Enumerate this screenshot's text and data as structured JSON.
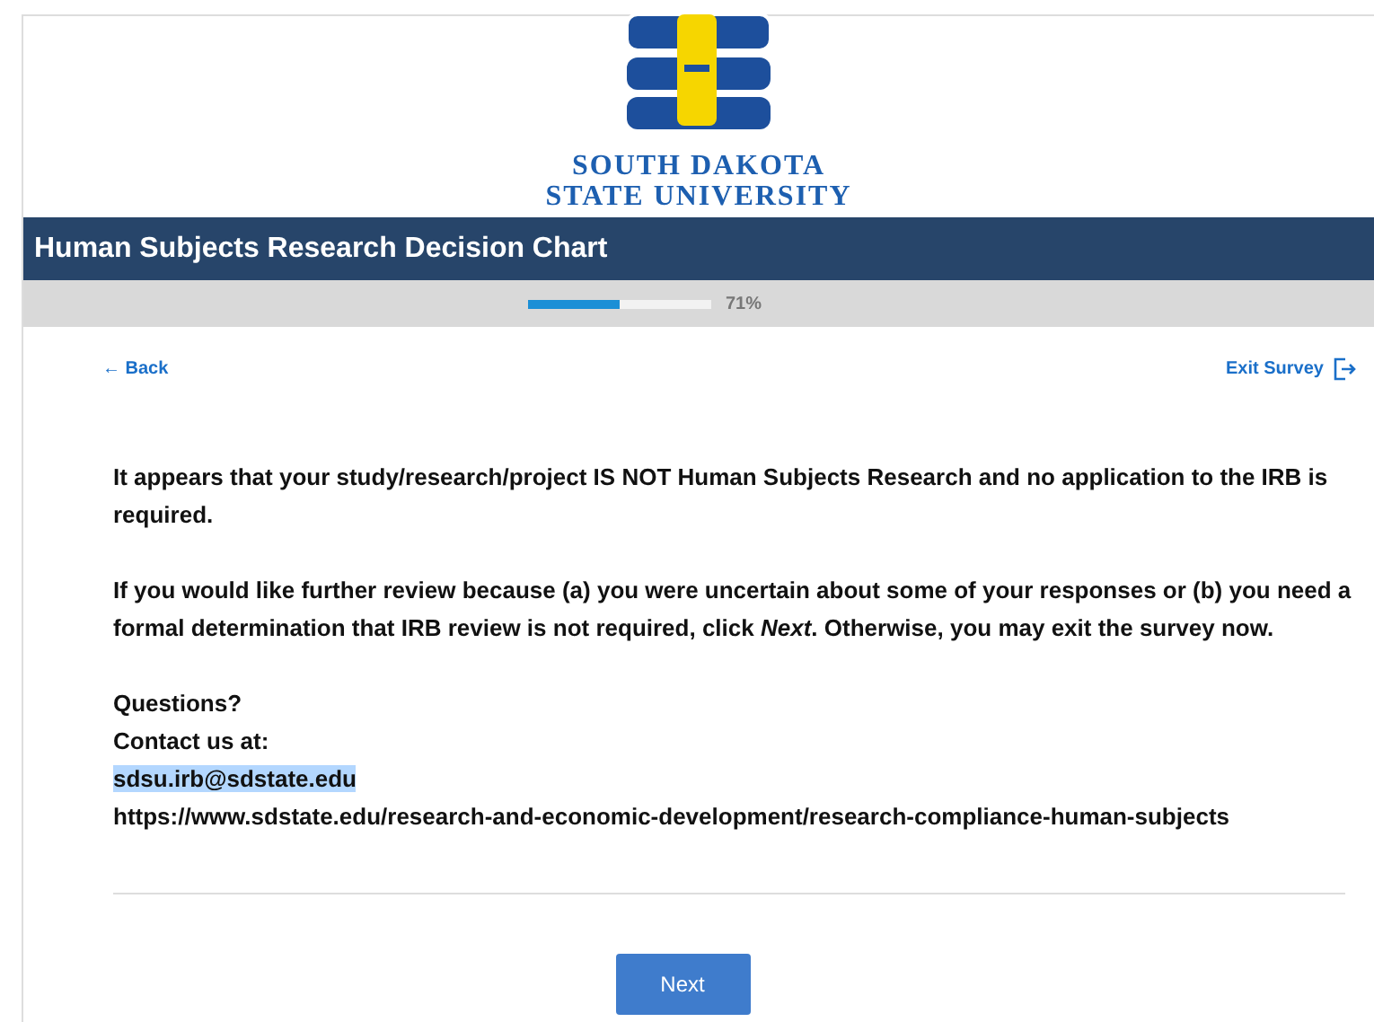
{
  "logo": {
    "line_1": "SOUTH DAKOTA",
    "line_2": "STATE UNIVERSITY"
  },
  "header": {
    "title": "Human Subjects Research Decision Chart"
  },
  "progress": {
    "level": 0.5,
    "reading": "71%"
  },
  "nav": {
    "back": "← Back",
    "exit": "Exit Survey"
  },
  "paragraphs": [
    "It appears that your study/research/project IS NOT Human Subjects Research and no application to the IRB is required.",
    "If you would like further review because (a) you were uncertain about some of your responses or (b) you need a formal determination that IRB review is not required, click *Next*. Otherwise, you may exit the survey now."
  ],
  "contact": {
    "lines": [
      "Questions?",
      "Contact us at:"
    ],
    "email": "sdsu.irb@sdstate.edu",
    "email_highlighted": true,
    "url": "https://www.sdstate.edu/research-and-economic-development/research-compliance-human-subjects"
  },
  "buttons": [
    {
      "label": "Next"
    }
  ]
}
